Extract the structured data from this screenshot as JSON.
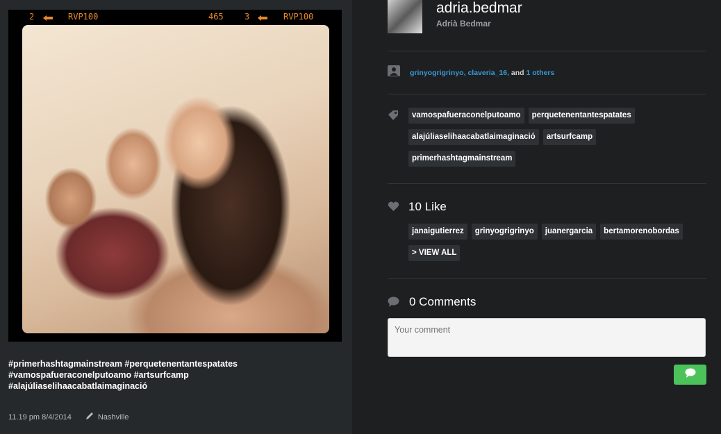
{
  "photo": {
    "film_marks": {
      "left_number": "2",
      "left_code": "RVP100",
      "mid_number": "465",
      "right_number": "3",
      "right_code": "RVP100"
    },
    "caption_lines": [
      "#primerhashtagmainstream #perquetenentantespatates",
      "#vamospafueraconelputoamo #artsurfcamp",
      "#alajúliaselihaacabatlaimaginació"
    ],
    "timestamp": "11.19 pm 8/4/2014",
    "location": "Nashville"
  },
  "user": {
    "username": "adria.bedmar",
    "full_name": "Adrià Bedmar"
  },
  "tagged": {
    "user1": "grinyogrigrinyo,",
    "user2": "claveria_16,",
    "and_text": "and",
    "others": "1 others"
  },
  "hashtags": [
    "vamospafueraconelputoamo",
    "perquetenentantespatates",
    "alajúliaselihaacabatlaimaginació",
    "artsurfcamp",
    "primerhashtagmainstream"
  ],
  "likes": {
    "title": "10 Like",
    "users": [
      "janaigutierrez",
      "grinyogrigrinyo",
      "juanergarcia",
      "bertamorenobordas"
    ],
    "view_all": "> VIEW ALL"
  },
  "comments": {
    "title": "0 Comments",
    "placeholder": "Your comment"
  },
  "colors": {
    "link": "#3a9ad9",
    "send_button": "#4cc35a",
    "film_text": "#e8892a"
  }
}
